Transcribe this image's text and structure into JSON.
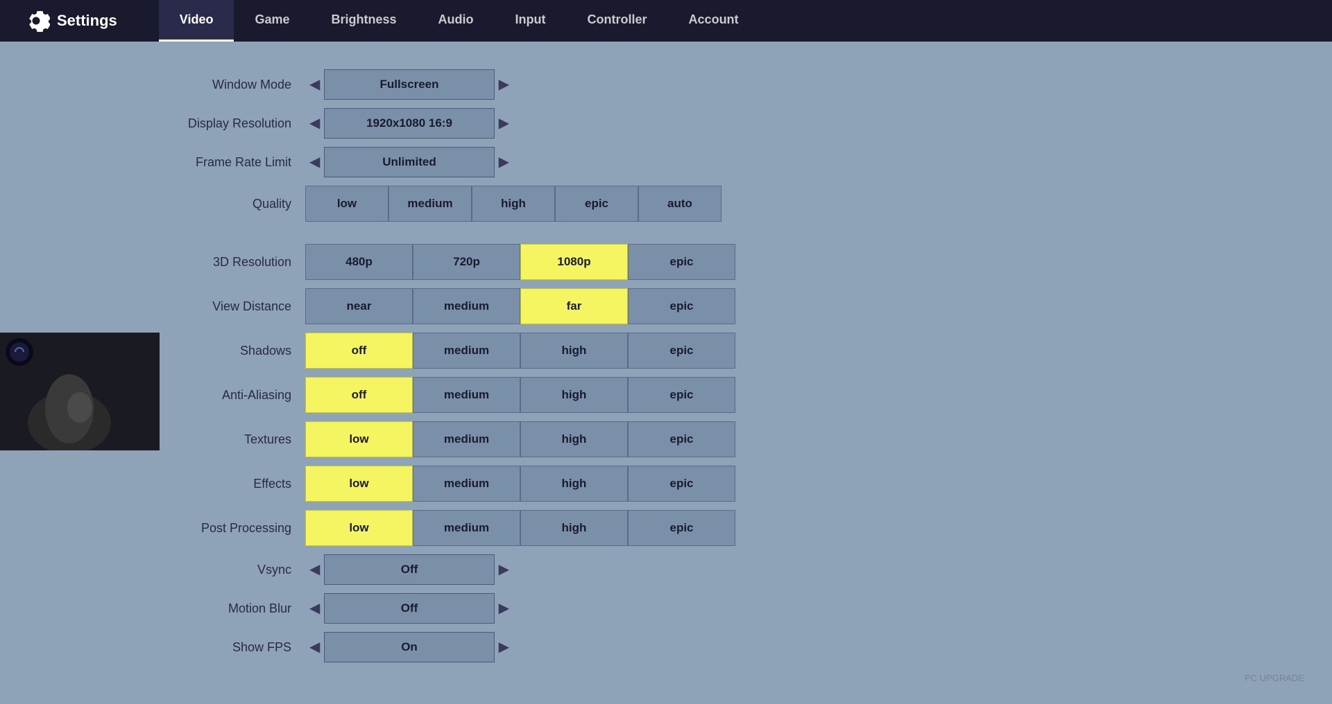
{
  "header": {
    "title": "Settings",
    "tabs": [
      {
        "label": "Video",
        "active": true
      },
      {
        "label": "Game",
        "active": false
      },
      {
        "label": "Brightness",
        "active": false
      },
      {
        "label": "Audio",
        "active": false
      },
      {
        "label": "Input",
        "active": false
      },
      {
        "label": "Controller",
        "active": false
      },
      {
        "label": "Account",
        "active": false
      }
    ]
  },
  "settings": {
    "window_mode": {
      "label": "Window Mode",
      "value": "Fullscreen"
    },
    "display_resolution": {
      "label": "Display Resolution",
      "value": "1920x1080 16:9"
    },
    "frame_rate_limit": {
      "label": "Frame Rate Limit",
      "value": "Unlimited"
    },
    "quality": {
      "label": "Quality",
      "options": [
        "low",
        "medium",
        "high",
        "epic",
        "auto"
      ],
      "selected": null
    },
    "resolution_3d": {
      "label": "3D Resolution",
      "options": [
        "480p",
        "720p",
        "1080p",
        "epic"
      ],
      "selected": "1080p"
    },
    "view_distance": {
      "label": "View Distance",
      "options": [
        "near",
        "medium",
        "far",
        "epic"
      ],
      "selected": "far"
    },
    "shadows": {
      "label": "Shadows",
      "options": [
        "off",
        "medium",
        "high",
        "epic"
      ],
      "selected": "off"
    },
    "anti_aliasing": {
      "label": "Anti-Aliasing",
      "options": [
        "off",
        "medium",
        "high",
        "epic"
      ],
      "selected": "off"
    },
    "textures": {
      "label": "Textures",
      "options": [
        "low",
        "medium",
        "high",
        "epic"
      ],
      "selected": "low"
    },
    "effects": {
      "label": "Effects",
      "options": [
        "low",
        "medium",
        "high",
        "epic"
      ],
      "selected": "low"
    },
    "post_processing": {
      "label": "Post Processing",
      "options": [
        "low",
        "medium",
        "high",
        "epic"
      ],
      "selected": "low"
    },
    "vsync": {
      "label": "Vsync",
      "value": "Off"
    },
    "motion_blur": {
      "label": "Motion Blur",
      "value": "Off"
    },
    "show_fps": {
      "label": "Show FPS",
      "value": "On"
    }
  },
  "watermark": "PC UPGRADE"
}
